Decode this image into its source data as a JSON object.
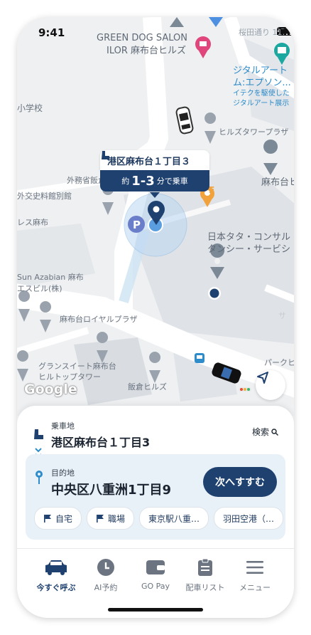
{
  "status_bar": {
    "time": "9:41"
  },
  "map": {
    "pois": {
      "green_dog_salon": "GREEN DOG SALON",
      "ilor": "ILOR 麻布台ヒルズ",
      "digital_art_1": "ジタルアート",
      "digital_art_2": "ム:エプソン...",
      "digital_art_3": "イテクを駆使した",
      "digital_art_4": "ジタルアート展示",
      "school": "小学校",
      "hills_tower": "ヒルズタワープラザ",
      "gaimusho": "外務省飯倉...",
      "azabudai_hi": "麻布台ヒ",
      "gaiko": "外交史料館別館",
      "resu_azabu": "レス麻布",
      "nihon_tata_1": "日本タタ・コンサル",
      "nihon_tata_2": "タンシー・サービシ",
      "sun_azabian_1": "Sun Azabian 麻布",
      "sun_azabian_2": "エスビル(株)",
      "royal_plaza": "麻布台ロイヤルプラザ",
      "grand_suite_1": "グランスイート麻布台",
      "grand_suite_2": "ヒルトップタワー",
      "iikura_hills": "飯倉ヒルズ",
      "park_hills": "パークヒル",
      "sa": "サ",
      "street_mark": "F",
      "road_label": "桜田通り 11"
    },
    "callout": {
      "title": "港区麻布台１丁目３",
      "prefix": "約",
      "eta": "1-3",
      "suffix": "分で乗車"
    },
    "google_label": "Google"
  },
  "sheet": {
    "pickup_label": "乗車地",
    "pickup_value": "港区麻布台１丁目3",
    "search_label": "検索",
    "dest_label": "目的地",
    "dest_value": "中央区八重洲1丁目9",
    "next_button": "次へすすむ",
    "chips": [
      "自宅",
      "職場",
      "東京駅八重…",
      "羽田空港（…"
    ]
  },
  "tabs": [
    {
      "label": "今すぐ呼ぶ",
      "icon": "taxi-icon"
    },
    {
      "label": "AI予約",
      "icon": "clock-icon"
    },
    {
      "label": "GO Pay",
      "icon": "wallet-icon"
    },
    {
      "label": "配車リスト",
      "icon": "clipboard-icon"
    },
    {
      "label": "メニュー",
      "icon": "menu-icon"
    }
  ],
  "colors": {
    "brand": "#1f4170",
    "accent_blue": "#2d8cc9",
    "orange": "#f2a23b",
    "parking": "#6b7ec9"
  }
}
